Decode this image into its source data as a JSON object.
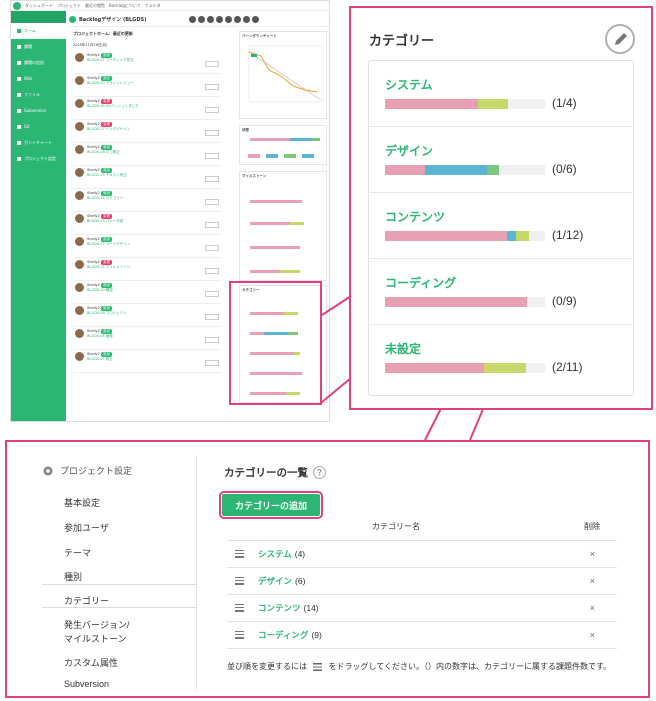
{
  "app": {
    "topnav": "ダッシュボード　プロジェクト　最近の閲覧　Backlogについて　フォルダ",
    "project_name": "Backlogデザイン (BLGDS)",
    "sidebar": [
      "ホーム",
      "課題",
      "課題の追加",
      "Wiki",
      "ファイル",
      "Subversion",
      "Git",
      "ガントチャート",
      "プロジェクト設定"
    ],
    "feed_title": "プロジェクトホーム：最近の更新",
    "feed_date": "2015年11月16日(月)",
    "feed_entries": [
      {
        "user": "Shelly2",
        "tag": "追加",
        "text": "BLGDS-21 コーディング担当"
      },
      {
        "user": "Shelly2",
        "tag": "追加",
        "text": "BLGDS-20 デザインレビュー"
      },
      {
        "user": "Shelly2",
        "tag": "変更",
        "text": "BLGDS-18 Gitプッシュしました"
      },
      {
        "user": "Shelly2",
        "tag": "変更",
        "text": "BLGDS-17 ヘッダデザイン"
      },
      {
        "user": "Shelly2",
        "tag": "追加",
        "text": "BLGDS-16 ロゴ修正"
      },
      {
        "user": "Shelly2",
        "tag": "追加",
        "text": "BLGDS-15 テキスト修正"
      },
      {
        "user": "Shelly2",
        "tag": "追加",
        "text": "BLGDS-14 カテゴリー"
      },
      {
        "user": "Shelly2",
        "tag": "変更",
        "text": "BLGDS-13 バナー作成"
      },
      {
        "user": "Shelly2",
        "tag": "追加",
        "text": "BLGDS-12 ページデザイン"
      },
      {
        "user": "Shelly2",
        "tag": "変更",
        "text": "BLGDS-11 マイルストーン"
      },
      {
        "user": "Shelly2",
        "tag": "追加",
        "text": "BLGDS-10 確認"
      },
      {
        "user": "Shelly2",
        "tag": "追加",
        "text": "BLGDS-09 プロジェクト"
      },
      {
        "user": "Shelly2",
        "tag": "追加",
        "text": "BLGDS-08 画像"
      },
      {
        "user": "Shelly2",
        "tag": "追加",
        "text": "BLGDS-07 修正"
      }
    ],
    "burndown_title": "バーンダウンチャート",
    "status_title": "状態",
    "milestone_title": "マイルストーン",
    "mini_category_title": "カテゴリー"
  },
  "category_panel": {
    "title": "カテゴリー",
    "categories": [
      {
        "name": "システム",
        "count": "(1/4)",
        "segments": [
          0.58,
          0,
          0.19
        ]
      },
      {
        "name": "デザイン",
        "count": "(0/6)",
        "segments": [
          0.25,
          0.39,
          0.07
        ]
      },
      {
        "name": "コンテンツ",
        "count": "(1/12)",
        "segments": [
          0.76,
          0.06,
          0.08
        ]
      },
      {
        "name": "コーディング",
        "count": "(0/9)",
        "segments": [
          0.89,
          0,
          0
        ]
      },
      {
        "name": "未設定",
        "count": "(2/11)",
        "segments": [
          0.62,
          0,
          0.26
        ]
      }
    ]
  },
  "colors": {
    "pink": "#e8a0b4",
    "blue": "#5ab4d2",
    "green": "#7cc67e",
    "lime": "#c6d86a",
    "brand": "#2bb673",
    "highlight": "#e0407f"
  },
  "settings": {
    "header": "プロジェクト設定",
    "menu": [
      "基本設定",
      "参加ユーザ",
      "テーマ",
      "種別",
      "カテゴリー",
      "発生バージョン/",
      "マイルストーン",
      "カスタム属性",
      "Subversion"
    ],
    "list_title": "カテゴリーの一覧",
    "help": "?",
    "add_button": "カテゴリーの追加",
    "col_name": "カテゴリー名",
    "col_delete": "削除",
    "rows": [
      {
        "name": "システム",
        "count": "(4)"
      },
      {
        "name": "デザイン",
        "count": "(6)"
      },
      {
        "name": "コンテンツ",
        "count": "(14)"
      },
      {
        "name": "コーディング",
        "count": "(9)"
      }
    ],
    "delete_glyph": "×",
    "footnote_a": "並び順を変更するには",
    "footnote_b": "をドラッグしてください。（）内の数字は、カテゴリーに属する課題件数です。"
  }
}
